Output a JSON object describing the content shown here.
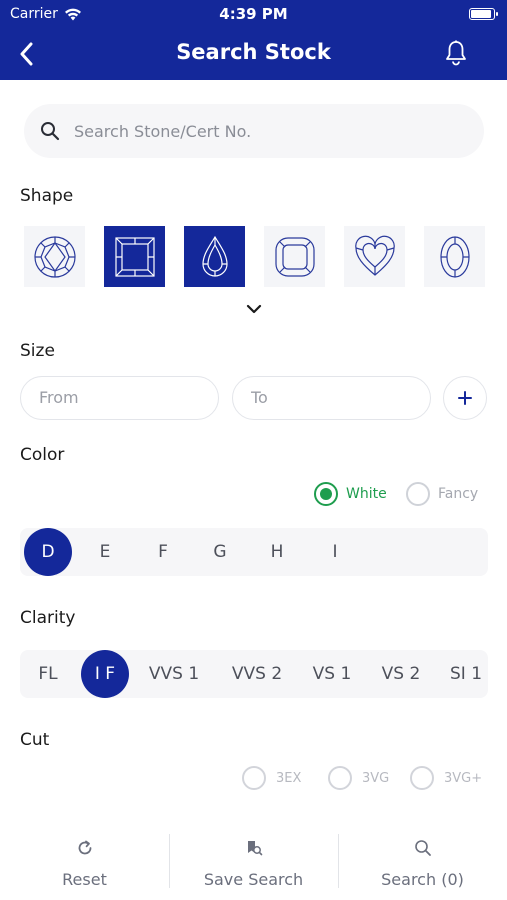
{
  "status_bar": {
    "carrier": "Carrier",
    "time": "4:39 PM"
  },
  "header": {
    "title": "Search Stock"
  },
  "search": {
    "placeholder": "Search Stone/Cert No."
  },
  "shape": {
    "label": "Shape",
    "items": [
      {
        "icon": "round-diamond-icon",
        "selected": false
      },
      {
        "icon": "princess-diamond-icon",
        "selected": true
      },
      {
        "icon": "pear-diamond-icon",
        "selected": true
      },
      {
        "icon": "cushion-diamond-icon",
        "selected": false
      },
      {
        "icon": "heart-diamond-icon",
        "selected": false
      },
      {
        "icon": "oval-diamond-icon",
        "selected": false
      }
    ]
  },
  "size": {
    "label": "Size",
    "from_placeholder": "From",
    "to_placeholder": "To"
  },
  "color": {
    "label": "Color",
    "type_options": [
      {
        "label": "White",
        "selected": true
      },
      {
        "label": "Fancy",
        "selected": false
      }
    ],
    "grades": [
      "D",
      "E",
      "F",
      "G",
      "H",
      "I"
    ],
    "selected_grade": "D"
  },
  "clarity": {
    "label": "Clarity",
    "grades": [
      "FL",
      "I F",
      "VVS 1",
      "VVS 2",
      "VS 1",
      "VS 2",
      "SI 1"
    ],
    "selected_grade": "I F"
  },
  "cut": {
    "label": "Cut",
    "options": [
      "3EX",
      "3VG",
      "3VG+"
    ]
  },
  "bottom_bar": {
    "reset": "Reset",
    "save_search": "Save Search",
    "search": "Search (0)"
  },
  "colors": {
    "primary": "#14289a",
    "accent_green": "#1e9d4e"
  }
}
